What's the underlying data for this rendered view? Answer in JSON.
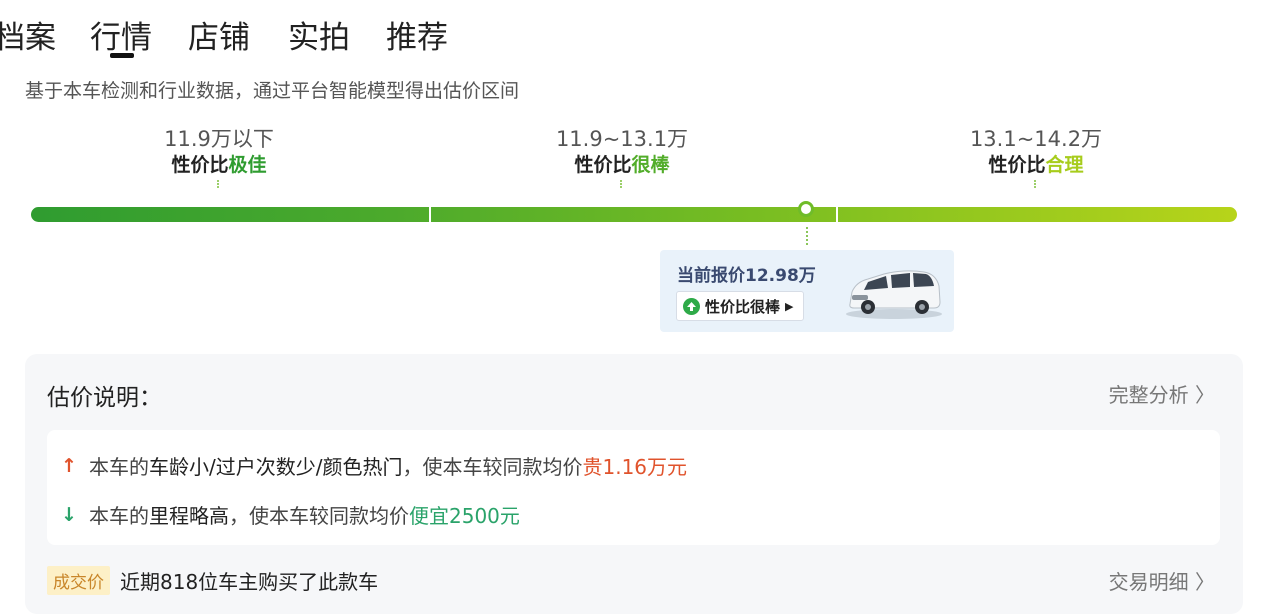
{
  "tabs": [
    {
      "label": "档案"
    },
    {
      "label": "行情"
    },
    {
      "label": "店铺"
    },
    {
      "label": "实拍"
    },
    {
      "label": "推荐"
    }
  ],
  "active_tab": "行情",
  "subtitle": "基于本车检测和行业数据，通过平台智能模型得出估价区间",
  "segments": [
    {
      "range": "11.9万以下",
      "rating_prefix": "性价比",
      "rating_word": "极佳",
      "color": "#2f9c30"
    },
    {
      "range": "11.9~13.1万",
      "rating_prefix": "性价比",
      "rating_word": "很棒",
      "color": "#52ad2a"
    },
    {
      "range": "13.1~14.2万",
      "rating_prefix": "性价比",
      "rating_word": "合理",
      "color": "#a7cc1c"
    }
  ],
  "price_bar": {
    "min_label": "11.9万",
    "segment_bounds_wan": [
      11.9,
      13.1
    ],
    "current_price_wan": 12.98,
    "colors": [
      "#2f9c30",
      "#78bd22",
      "#b7d41a"
    ]
  },
  "price_card": {
    "price_text": "当前报价12.98万",
    "badge_label": "性价比很棒"
  },
  "explanation": {
    "title": "估价说明：",
    "full_analysis_link": "完整分析 〉",
    "reasons": [
      {
        "direction": "up",
        "icon": "arrow-up-icon",
        "prefix": "本车的",
        "highlight": "车龄小/过户次数少/颜色热门",
        "middle": "，使本车较同款均价",
        "value": "贵1.16万元",
        "value_color": "#e0532c"
      },
      {
        "direction": "down",
        "icon": "arrow-down-icon",
        "prefix": "本车的",
        "highlight": "里程略高",
        "middle": "，使本车较同款均价",
        "value": "便宜2500元",
        "value_color": "#2aa36a"
      }
    ]
  },
  "deal": {
    "badge": "成交价",
    "text": "近期818位车主购买了此款车",
    "link": "交易明细 〉"
  }
}
